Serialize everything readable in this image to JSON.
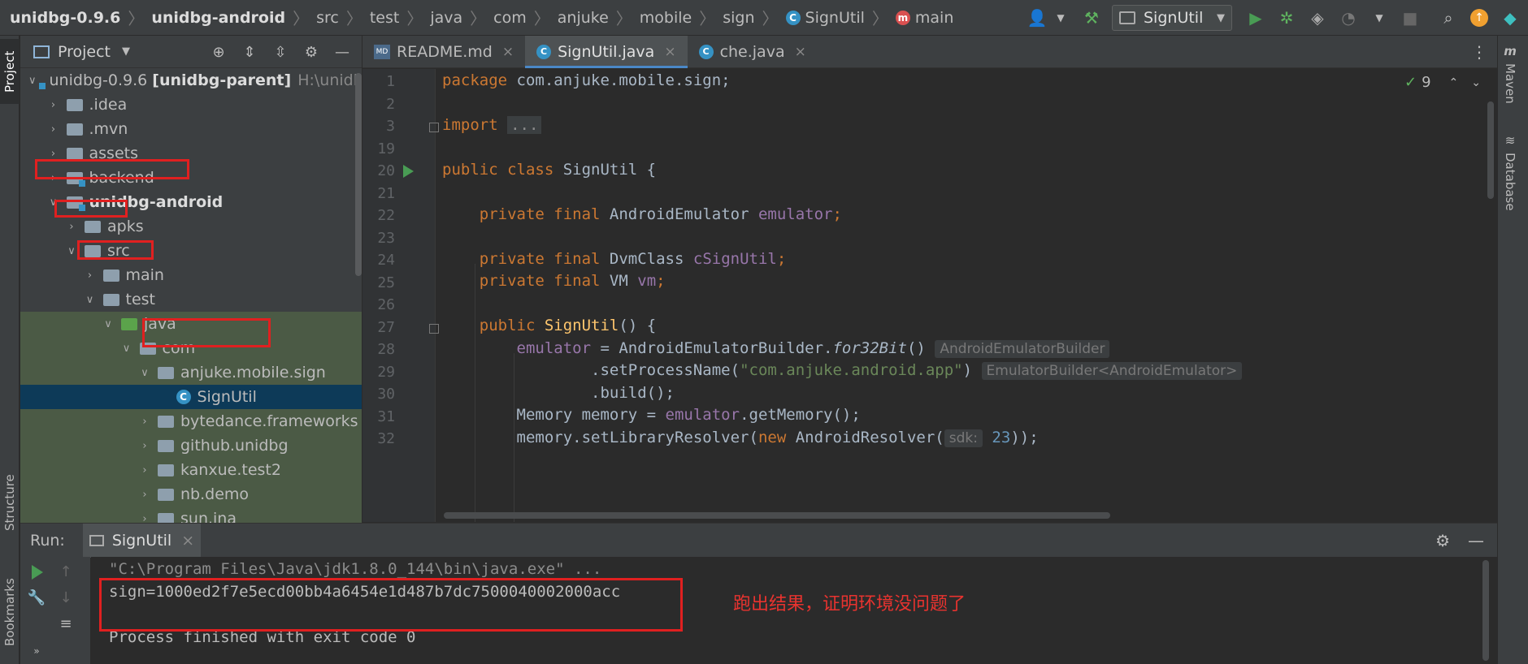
{
  "breadcrumbs": [
    {
      "label": "unidbg-0.9.6",
      "bold": true
    },
    {
      "label": "unidbg-android",
      "bold": true
    },
    {
      "label": "src"
    },
    {
      "label": "test"
    },
    {
      "label": "java"
    },
    {
      "label": "com"
    },
    {
      "label": "anjuke"
    },
    {
      "label": "mobile"
    },
    {
      "label": "sign"
    },
    {
      "label": "SignUtil",
      "icon": "class-icon"
    },
    {
      "label": "main",
      "icon": "method-icon"
    }
  ],
  "toolbar": {
    "run_config": "SignUtil",
    "icons": [
      "user-icon",
      "build-hammer-icon",
      "run-icon",
      "debug-icon",
      "coverage-icon",
      "profile-icon",
      "stop-icon",
      "search-icon",
      "update-icon",
      "jetbrains-icon"
    ]
  },
  "left_strip": {
    "project": "Project",
    "structure": "Structure",
    "bookmarks": "Bookmarks"
  },
  "right_strip": {
    "maven": "Maven",
    "database": "Database"
  },
  "project_panel": {
    "title": "Project",
    "tree": [
      {
        "label": "unidbg-0.9.6",
        "bold_suffix": "[unidbg-parent]",
        "path": "H:\\unidbg",
        "indent": 0,
        "open": true,
        "kind": "module"
      },
      {
        "label": ".idea",
        "indent": 1,
        "open": false,
        "kind": "folder"
      },
      {
        "label": ".mvn",
        "indent": 1,
        "open": false,
        "kind": "folder"
      },
      {
        "label": "assets",
        "indent": 1,
        "open": false,
        "kind": "folder"
      },
      {
        "label": "backend",
        "indent": 1,
        "open": false,
        "kind": "module"
      },
      {
        "label": "unidbg-android",
        "indent": 1,
        "open": true,
        "kind": "module",
        "bold": true
      },
      {
        "label": "apks",
        "indent": 2,
        "open": false,
        "kind": "folder"
      },
      {
        "label": "src",
        "indent": 2,
        "open": true,
        "kind": "folder"
      },
      {
        "label": "main",
        "indent": 3,
        "open": false,
        "kind": "folder"
      },
      {
        "label": "test",
        "indent": 3,
        "open": true,
        "kind": "folder"
      },
      {
        "label": "java",
        "indent": 4,
        "open": true,
        "kind": "java",
        "green": true
      },
      {
        "label": "com",
        "indent": 5,
        "open": true,
        "kind": "pkg",
        "green": true
      },
      {
        "label": "anjuke.mobile.sign",
        "indent": 6,
        "open": true,
        "kind": "pkg",
        "green": true
      },
      {
        "label": "SignUtil",
        "indent": 7,
        "kind": "class",
        "selected": true
      },
      {
        "label": "bytedance.frameworks",
        "indent": 6,
        "open": false,
        "kind": "pkg",
        "green": true
      },
      {
        "label": "github.unidbg",
        "indent": 6,
        "open": false,
        "kind": "pkg",
        "green": true
      },
      {
        "label": "kanxue.test2",
        "indent": 6,
        "open": false,
        "kind": "pkg",
        "green": true
      },
      {
        "label": "nb.demo",
        "indent": 6,
        "open": false,
        "kind": "pkg",
        "green": true
      },
      {
        "label": "sun.jna",
        "indent": 6,
        "open": false,
        "kind": "pkg",
        "green": true
      }
    ]
  },
  "editor": {
    "tabs": [
      {
        "label": "README.md",
        "icon": "markdown-icon",
        "active": false
      },
      {
        "label": "SignUtil.java",
        "icon": "class-icon",
        "active": true
      },
      {
        "label": "che.java",
        "icon": "class-icon",
        "active": false
      }
    ],
    "inspection_count": "9",
    "line_numbers": [
      "1",
      "2",
      "3",
      "19",
      "20",
      "21",
      "22",
      "23",
      "24",
      "25",
      "26",
      "27",
      "28",
      "29",
      "30",
      "31",
      "32"
    ],
    "code": {
      "l1_kw": "package",
      "l1_rest": " com.anjuke.mobile.sign;",
      "l3_kw": "import",
      "l3_fold": "...",
      "l20_kw": "public class",
      "l20_rest": " SignUtil {",
      "l22_kw": "private final",
      "l22_type": " AndroidEmulator ",
      "l22_fld": "emulator",
      "l22_end": ";",
      "l24_kw": "private final",
      "l24_type": " DvmClass ",
      "l24_fld": "cSignUtil",
      "l24_end": ";",
      "l25_kw": "private final",
      "l25_type": " VM ",
      "l25_fld": "vm",
      "l25_end": ";",
      "l27_kw": "public",
      "l27_fn": "SignUtil",
      "l27_rest": "() {",
      "l28_fld": "emulator",
      "l28_mid": " = AndroidEmulatorBuilder.",
      "l28_it": "for32Bit",
      "l28_end": "()",
      "l28_hint": "AndroidEmulatorBuilder",
      "l29_start": ".setProcessName(",
      "l29_str": "\"com.anjuke.android.app\"",
      "l29_end": ")",
      "l29_hint": "EmulatorBuilder<AndroidEmulator>",
      "l30": ".build();",
      "l31_start": "Memory memory = ",
      "l31_fld": "emulator",
      "l31_end": ".getMemory();",
      "l32_start": "memory.setLibraryResolver(",
      "l32_kw": "new",
      "l32_mid": " AndroidResolver(",
      "l32_hint": "sdk:",
      "l32_num": "23",
      "l32_end": "));"
    }
  },
  "run": {
    "label": "Run:",
    "tab": "SignUtil",
    "console": [
      "\"C:\\Program Files\\Java\\jdk1.8.0_144\\bin\\java.exe\" ...",
      "sign=1000ed2f7e5ecd00bb4a6454e1d487b7dc7500040002000acc",
      "",
      "Process finished with exit code 0"
    ],
    "annotation": "跑出结果，证明环境没问题了"
  },
  "colors": {
    "annotation_red": "#e02020",
    "keyword": "#cc7832",
    "field": "#9876aa",
    "string": "#6a8759",
    "selection": "#0d3a58"
  }
}
